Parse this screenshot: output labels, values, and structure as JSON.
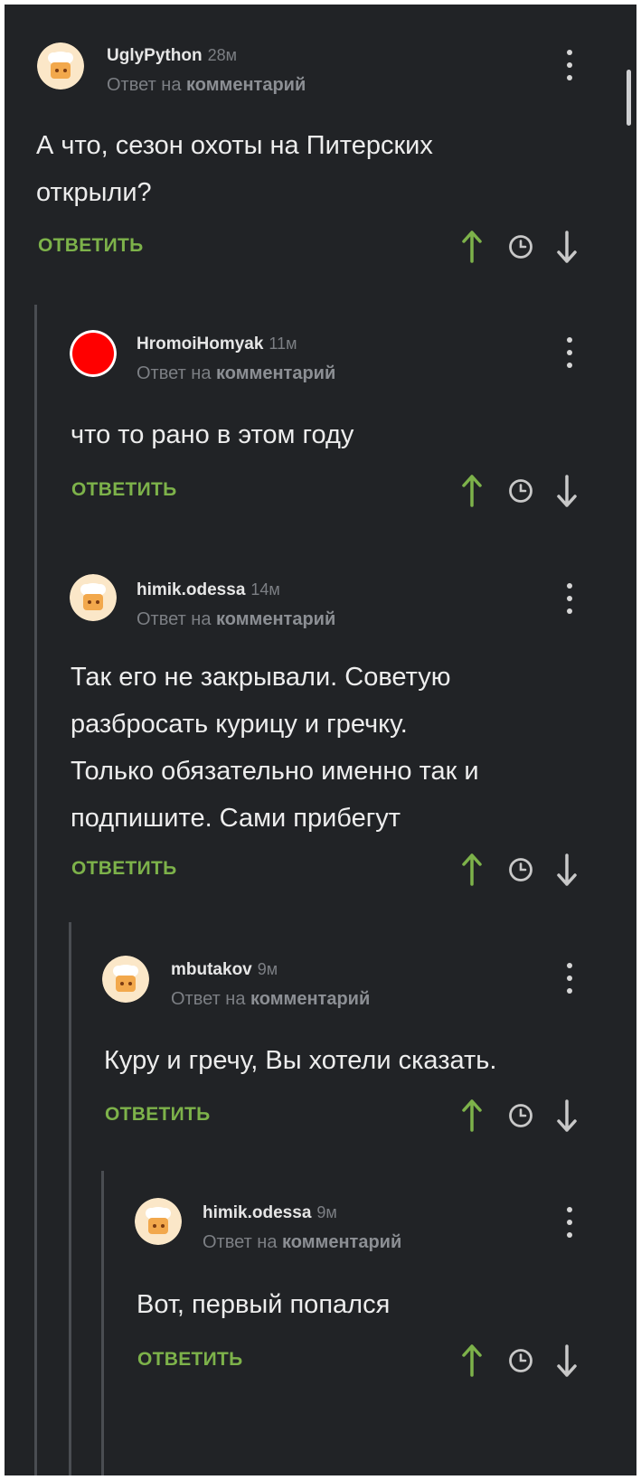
{
  "labels": {
    "reply_prefix": "Ответ на",
    "reply_target": "комментарий",
    "reply_button": "ОТВЕТИТЬ"
  },
  "colors": {
    "background": "#212326",
    "accent_green": "#7db24a",
    "text": "#ededed",
    "muted": "#7c7f84"
  },
  "comments": [
    {
      "author": "UglyPython",
      "time": "28м",
      "avatar": "chef-avatar",
      "text": [
        "А что, сезон охоты на Питерских",
        "открыли?"
      ]
    },
    {
      "author": "HromoiHomyak",
      "time": "11м",
      "avatar": "red-circle-avatar",
      "text": [
        "что то рано в этом году"
      ]
    },
    {
      "author": "himik.odessa",
      "time": "14м",
      "avatar": "chef-avatar",
      "text": [
        "Так его не закрывали. Советую",
        "разбросать курицу и гречку.",
        "Только обязательно именно так и",
        "подпишите. Сами прибегут"
      ]
    },
    {
      "author": "mbutakov",
      "time": "9м",
      "avatar": "chef-avatar",
      "text": [
        "Куру и гречу, Вы хотели сказать."
      ]
    },
    {
      "author": "himik.odessa",
      "time": "9м",
      "avatar": "chef-avatar",
      "text": [
        "Вот, первый попался"
      ]
    }
  ]
}
